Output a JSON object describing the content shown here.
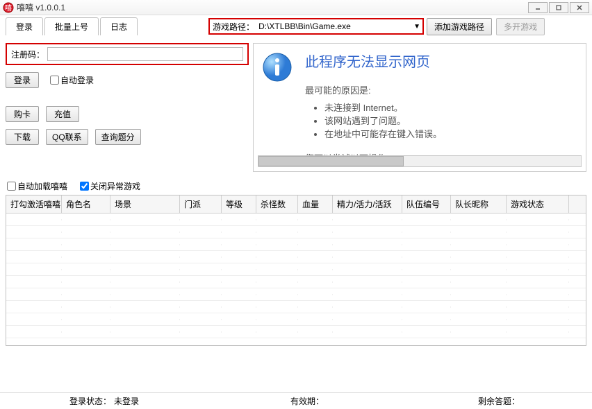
{
  "window": {
    "title": "嘻嘻 v1.0.0.1"
  },
  "tabs": {
    "login": "登录",
    "batch": "批量上号",
    "log": "日志"
  },
  "path": {
    "label": "游戏路径：",
    "value": "D:\\XTLBB\\Bin\\Game.exe"
  },
  "buttons": {
    "addPath": "添加游戏路径",
    "multiOpen": "多开游戏",
    "login": "登录",
    "buyCard": "购卡",
    "recharge": "充值",
    "download": "下载",
    "qqContact": "QQ联系",
    "queryScore": "查询题分"
  },
  "reg": {
    "label": "注册码：",
    "value": ""
  },
  "checks": {
    "autoLogin": "自动登录",
    "autoLoad": "自动加载嘻嘻",
    "closeAbnormal": "关闭异常游戏"
  },
  "ie": {
    "title": "此程序无法显示网页",
    "reasonHead": "最可能的原因是:",
    "reasons": [
      "未连接到 Internet。",
      "该网站遇到了问题。",
      "在地址中可能存在键入错误。"
    ],
    "tryHead": "您可以尝试以下操作:"
  },
  "grid": {
    "headers": [
      "打勾激活嘻嘻",
      "角色名",
      "场景",
      "门派",
      "等级",
      "杀怪数",
      "血量",
      "精力/活力/活跃",
      "队伍编号",
      "队长昵称",
      "游戏状态"
    ]
  },
  "status": {
    "loginLabel": "登录状态：",
    "loginValue": "未登录",
    "expireLabel": "有效期：",
    "expireValue": "",
    "remainLabel": "剩余答题：",
    "remainValue": ""
  }
}
